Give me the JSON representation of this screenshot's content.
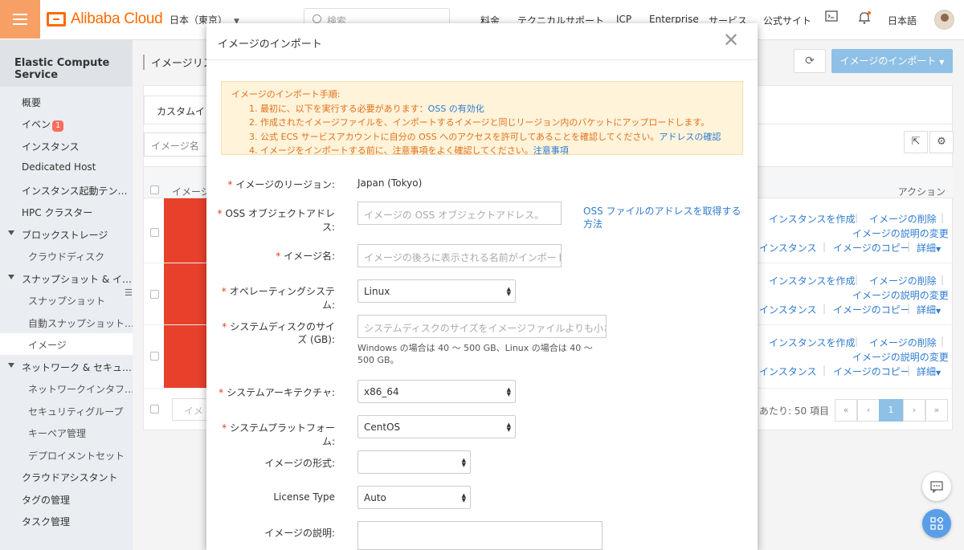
{
  "topbar": {
    "logo_text": "Alibaba Cloud",
    "region": "日本（東京）",
    "search_placeholder": "検索",
    "nav": [
      "料金",
      "テクニカルサポート",
      "ICP",
      "Enterprise",
      "サービス",
      "公式サイト"
    ],
    "language": "日本語"
  },
  "sidebar": {
    "title": "Elastic Compute Service",
    "items": [
      {
        "label": "概要"
      },
      {
        "label": "イベン",
        "badge": "1"
      },
      {
        "label": "インスタンス"
      },
      {
        "label": "Dedicated Host"
      },
      {
        "label": "インスタンス起動テン…"
      },
      {
        "label": "HPC クラスター"
      },
      {
        "label": "ブロックストレージ"
      },
      {
        "label": "クラウドディスク"
      },
      {
        "label": "スナップショット & イ…"
      },
      {
        "label": "スナップショット"
      },
      {
        "label": "自動スナップショット…"
      },
      {
        "label": "イメージ"
      },
      {
        "label": "ネットワーク & セキュ…"
      },
      {
        "label": "ネットワークインタフ…"
      },
      {
        "label": "セキュリティグループ"
      },
      {
        "label": "キーペア管理"
      },
      {
        "label": "デプロイメントセット"
      },
      {
        "label": "クラウドアシスタント"
      },
      {
        "label": "タグの管理"
      },
      {
        "label": "タスク管理"
      }
    ]
  },
  "main": {
    "page_title": "イメージリス",
    "import_button": "イメージのインポート",
    "tab_custom": "カスタムイ",
    "filter_placeholder": "イメージ名",
    "col_image": "イメージ",
    "col_action": "アクション",
    "rows": [
      {
        "a1": "インスタンスを作成",
        "a2": "イメージの削除",
        "a3": "イメージの説明の変更",
        "a4": "インスタンス",
        "a5": "イメージのコピー",
        "a6": "詳細"
      },
      {
        "a1": "インスタンスを作成",
        "a2": "イメージの削除",
        "a3": "イメージの説明の変更",
        "a4": "インスタンス",
        "a5": "イメージのコピー",
        "a6": "詳細"
      },
      {
        "a1": "インスタンスを作成",
        "a2": "イメージの削除",
        "a3": "イメージの説明の変更",
        "a4": "インスタンス",
        "a5": "イメージのコピー",
        "a6": "詳細"
      }
    ],
    "footer_btn": "イメ",
    "per_page": "あたり: 50 項目",
    "pager": [
      "«",
      "‹",
      "1",
      "›",
      "»"
    ]
  },
  "modal": {
    "title": "イメージのインポート",
    "notice": {
      "heading": "イメージのインポート手順:",
      "step1": "1. 最初に、以下を実行する必要があります：",
      "step1_link": "OSS の有効化",
      "step2": "2. 作成されたイメージファイルを、インポートするイメージと同じリージョン内のバケットにアップロードします。",
      "step3": "3. 公式 ECS サービスアカウントに自分の OSS へのアクセスを許可してあることを確認してください。",
      "step3_link": "アドレスの確認",
      "step4": "4. イメージをインポートする前に、注意事項をよく確認してください。",
      "step4_link": "注意事項"
    },
    "fields": {
      "region_label": "イメージのリージョン:",
      "region_value": "Japan (Tokyo)",
      "oss_label": "OSS オブジェクトアドレス:",
      "oss_placeholder": "イメージの OSS オブジェクトアドレス。",
      "oss_link": "OSS ファイルのアドレスを取得する方法",
      "name_label": "イメージ名:",
      "name_placeholder": "イメージの後ろに表示される名前がインポートさ",
      "os_label": "オペレーティングシステム:",
      "os_value": "Linux",
      "disk_label": "システムディスクのサイズ (GB):",
      "disk_placeholder": "システムディスクのサイズをイメージファイルよりも小さく",
      "disk_help": "Windows の場合は 40 〜 500 GB、Linux の場合は 40 〜 500 GB。",
      "arch_label": "システムアーキテクチャ:",
      "arch_value": "x86_64",
      "platform_label": "システムプラットフォーム:",
      "platform_value": "CentOS",
      "format_label": "イメージの形式:",
      "format_value": "",
      "license_label": "License Type",
      "license_value": "Auto",
      "desc_label": "イメージの説明:"
    }
  },
  "colors": {
    "brand": "#ff6a00",
    "primary_button": "#8fc0e6",
    "link": "#2e7bd1",
    "notice_text": "#e0711a",
    "required": "#e0411d"
  }
}
